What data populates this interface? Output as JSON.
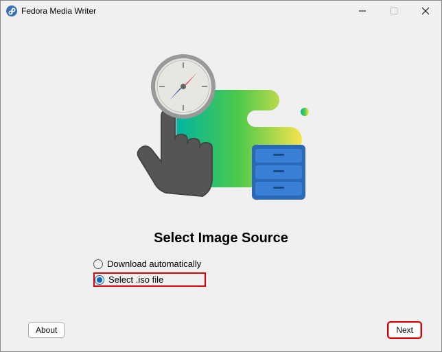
{
  "window": {
    "title": "Fedora Media Writer"
  },
  "heading": "Select Image Source",
  "options": {
    "download": "Download automatically",
    "iso": "Select .iso file",
    "selected": "iso"
  },
  "footer": {
    "about": "About",
    "next": "Next"
  }
}
